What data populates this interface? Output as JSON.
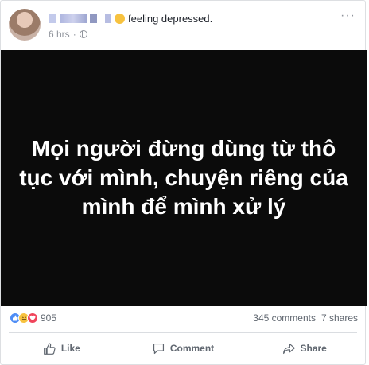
{
  "post": {
    "feeling": "feeling depressed.",
    "time": "6 hrs",
    "image_text": "Mọi người đừng dùng từ thô tục với mình, chuyện riêng của mình để mình xử lý"
  },
  "stats": {
    "reaction_count": "905",
    "comments": "345 comments",
    "shares": "7 shares"
  },
  "actions": {
    "like": "Like",
    "comment": "Comment",
    "share": "Share"
  },
  "icons": {
    "more": "more-options-icon",
    "privacy": "globe-icon",
    "feeling": "sad-face-icon"
  }
}
